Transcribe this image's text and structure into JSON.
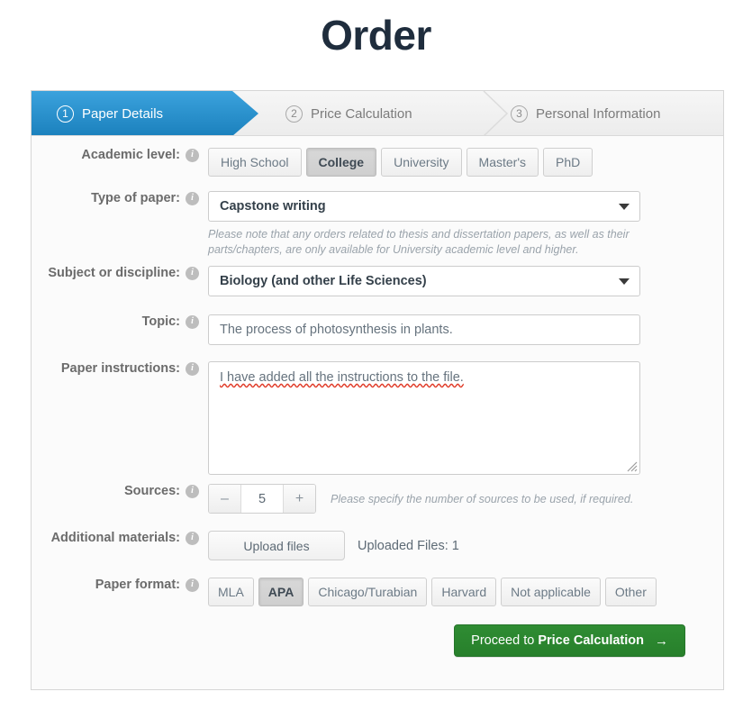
{
  "page": {
    "title": "Order"
  },
  "steps": [
    {
      "number": "1",
      "label": "Paper Details",
      "state": "active"
    },
    {
      "number": "2",
      "label": "Price Calculation",
      "state": "inactive"
    },
    {
      "number": "3",
      "label": "Personal Information",
      "state": "inactive"
    }
  ],
  "form": {
    "academic_level": {
      "label": "Academic level:",
      "options": [
        "High School",
        "College",
        "University",
        "Master's",
        "PhD"
      ],
      "selected": "College"
    },
    "type_of_paper": {
      "label": "Type of paper:",
      "value": "Capstone writing",
      "hint": "Please note that any orders related to thesis and dissertation papers, as well as their parts/chapters, are only available for University academic level and higher."
    },
    "subject": {
      "label": "Subject or discipline:",
      "value": "Biology (and other Life Sciences)"
    },
    "topic": {
      "label": "Topic:",
      "value": "The process of photosynthesis in plants."
    },
    "instructions": {
      "label": "Paper instructions:",
      "value": "I have added all the instructions to the file."
    },
    "sources": {
      "label": "Sources:",
      "value": "5",
      "decrement": "–",
      "increment": "+",
      "hint": "Please specify the number of sources to be used, if required."
    },
    "additional_materials": {
      "label": "Additional materials:",
      "upload_label": "Upload files",
      "uploaded_status": "Uploaded Files: 1"
    },
    "paper_format": {
      "label": "Paper format:",
      "options": [
        "MLA",
        "APA",
        "Chicago/Turabian",
        "Harvard",
        "Not applicable",
        "Other"
      ],
      "selected": "APA"
    }
  },
  "proceed": {
    "prefix": "Proceed to ",
    "emphasis": "Price Calculation",
    "arrow": "→"
  },
  "icons": {
    "info": "i"
  },
  "colors": {
    "active_tab": "#1b81bd",
    "proceed_green": "#2f8c33",
    "spellcheck_red": "#e03b28",
    "label_gray": "#6b6b6b"
  }
}
